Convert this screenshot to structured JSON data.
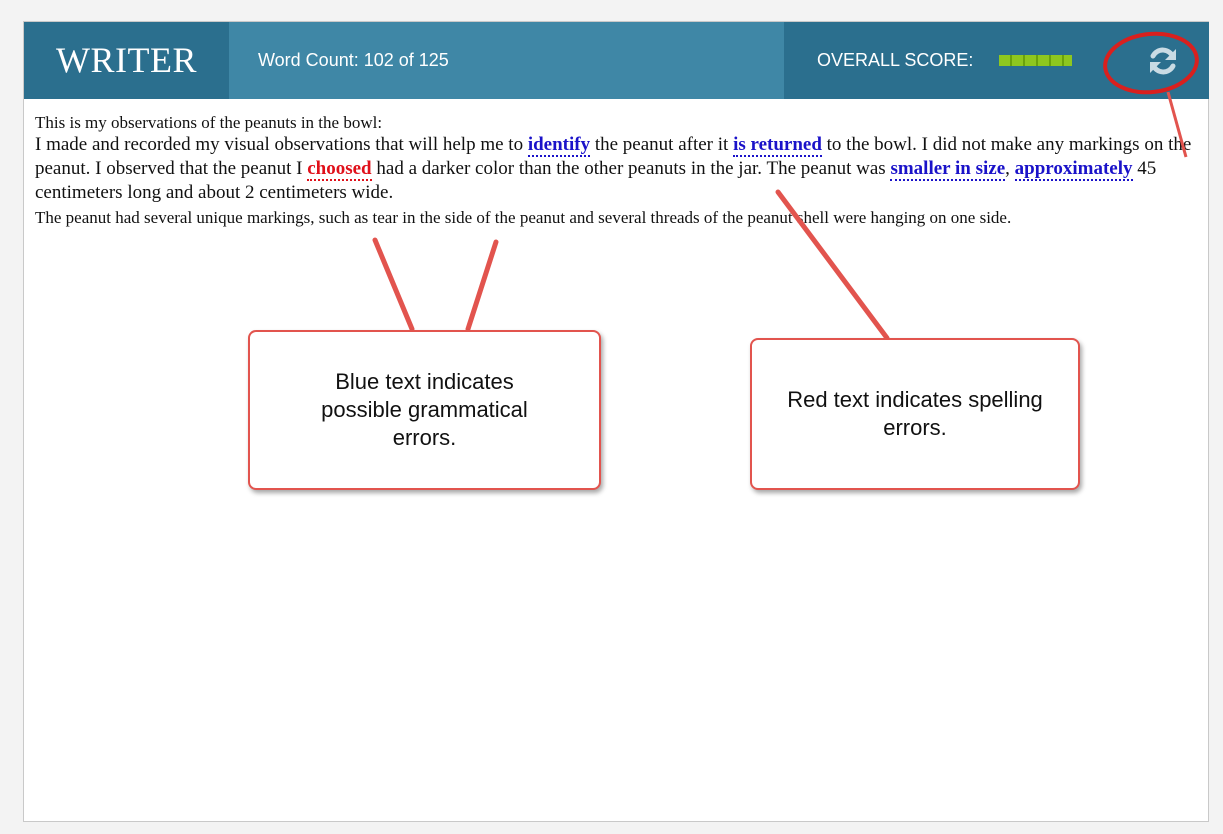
{
  "header": {
    "brand": "WRITER",
    "word_count": "Word Count: 102 of 125",
    "score_label": "OVERALL SCORE:",
    "score_fraction": 1.0,
    "refresh_icon": "refresh-icon"
  },
  "essay": {
    "line1": "This is my observations of the peanuts in the bowl:",
    "p2": {
      "t1": "I made and recorded my visual observations that will help me to ",
      "g1": "identify",
      "t2": " the peanut after it ",
      "g2": "is returned",
      "t3": " to the bowl. I did not make any markings on the peanut. I observed that the peanut I ",
      "s1": "choosed",
      "t4": " had a darker color than the other peanuts in the jar. The peanut was ",
      "g3": "smaller in size",
      "t5": ", ",
      "g4": "approximately",
      "t6": " 45 centimeters long and about 2 centimeters wide."
    },
    "p3": "The peanut had several unique markings, such as tear in the side of the peanut and several threads of the peanut shell were hanging on one side."
  },
  "callouts": {
    "blue": "Blue text indicates possible grammatical errors.",
    "red": "Red text indicates spelling errors."
  },
  "colors": {
    "header_bg": "#3f87a6",
    "brand_bg": "#2b6f8e",
    "grammar": "#1a12c9",
    "spelling": "#e0101a",
    "annotation": "#e2544e",
    "score_fill": "#8ec71f"
  }
}
